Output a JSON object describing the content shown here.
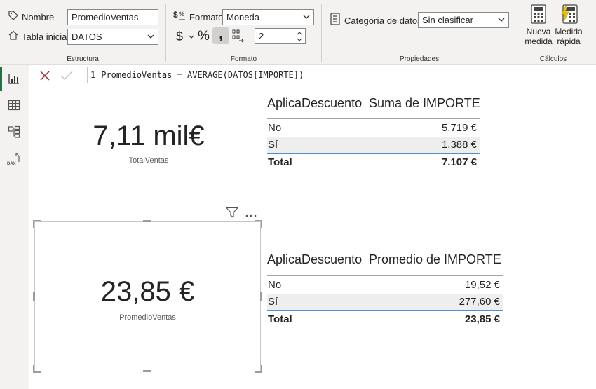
{
  "ribbon": {
    "estructura": {
      "nombre_label": "Nombre",
      "nombre_value": "PromedioVentas",
      "tabla_label": "Tabla inicial",
      "tabla_value": "DATOS",
      "group_label": "Estructura"
    },
    "formato": {
      "formato_label": "Formato",
      "formato_value": "Moneda",
      "currency_symbol": "$",
      "percent_symbol": "%",
      "comma_symbol": ",",
      "decimals_value": "2",
      "group_label": "Formato"
    },
    "propiedades": {
      "categoria_label": "Categoría de datos",
      "categoria_value": "Sin clasificar",
      "group_label": "Propiedades"
    },
    "calculos": {
      "nueva_line1": "Nueva",
      "nueva_line2": "medida",
      "rapida_line1": "Medida",
      "rapida_line2": "rápida",
      "group_label": "Cálculos"
    }
  },
  "formula_bar": {
    "line_number": "1",
    "formula": "PromedioVentas = AVERAGE(DATOS[IMPORTE])"
  },
  "left_nav": {
    "items": [
      "report-view",
      "table-view",
      "model-view",
      "dax-query-view"
    ],
    "dax_label": "DAX"
  },
  "visuals": {
    "card1": {
      "value": "7,11 mil€",
      "category": "TotalVentas"
    },
    "card2": {
      "value": "23,85 €",
      "category": "PromedioVentas"
    },
    "table1": {
      "col1": "AplicaDescuento",
      "col2": "Suma de IMPORTE",
      "rows": [
        {
          "label": "No",
          "value": "5.719 €"
        },
        {
          "label": "Sí",
          "value": "1.388 €"
        }
      ],
      "total_label": "Total",
      "total_value": "7.107 €"
    },
    "table2": {
      "col1": "AplicaDescuento",
      "col2": "Promedio de IMPORTE",
      "rows": [
        {
          "label": "No",
          "value": "19,52 €"
        },
        {
          "label": "Sí",
          "value": "277,60 €"
        }
      ],
      "total_label": "Total",
      "total_value": "23,85 €"
    }
  },
  "colors": {
    "accent_green": "#217346",
    "cancel_red": "#a4262c",
    "table_underline": "#4f8fd1",
    "selected_row": "#eeeeee"
  }
}
